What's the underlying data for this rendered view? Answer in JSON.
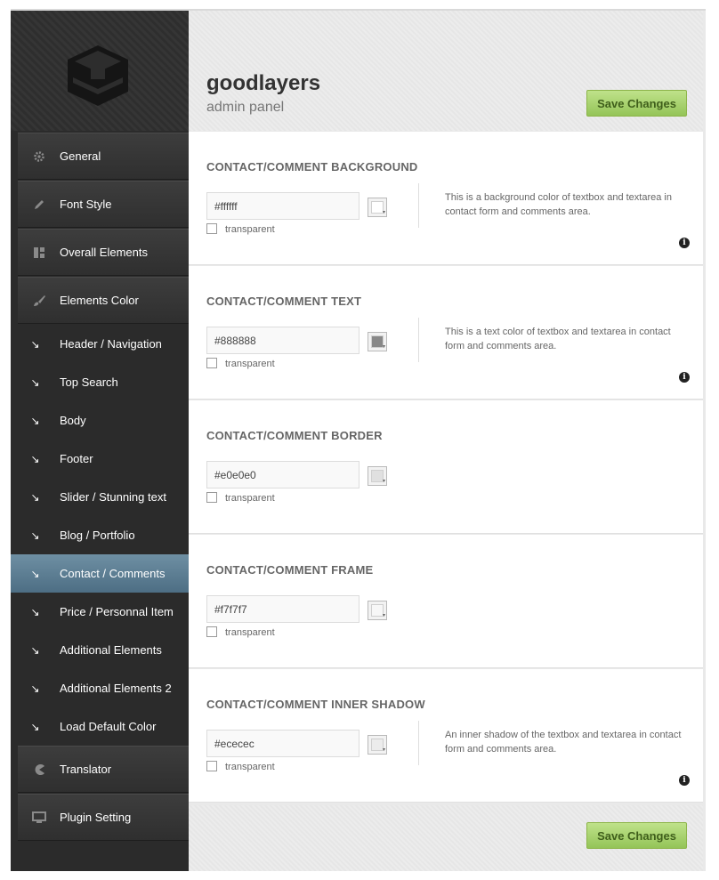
{
  "brand": {
    "title": "goodlayers",
    "subtitle": "admin panel"
  },
  "save_label": "Save Changes",
  "sidebar": {
    "main_items": [
      {
        "label": "General",
        "icon": "gear-icon"
      },
      {
        "label": "Font Style",
        "icon": "pencil-icon"
      },
      {
        "label": "Overall Elements",
        "icon": "layout-icon"
      },
      {
        "label": "Elements Color",
        "icon": "brush-icon"
      }
    ],
    "sub_items": [
      {
        "label": "Header / Navigation"
      },
      {
        "label": "Top Search"
      },
      {
        "label": "Body"
      },
      {
        "label": "Footer"
      },
      {
        "label": "Slider / Stunning text"
      },
      {
        "label": "Blog / Portfolio"
      },
      {
        "label": "Contact / Comments",
        "active": true
      },
      {
        "label": "Price / Personnal Item"
      },
      {
        "label": "Additional Elements"
      },
      {
        "label": "Additional Elements 2"
      },
      {
        "label": "Load Default Color"
      }
    ],
    "bottom_items": [
      {
        "label": "Translator",
        "icon": "pacman-icon"
      },
      {
        "label": "Plugin Setting",
        "icon": "monitor-icon"
      }
    ]
  },
  "sections": [
    {
      "title": "CONTACT/COMMENT BACKGROUND",
      "value": "#ffffff",
      "checkbox_label": "transparent",
      "description": "This is a background color of textbox and textarea in contact form and comments area.",
      "swatch": "#ffffff"
    },
    {
      "title": "CONTACT/COMMENT TEXT",
      "value": "#888888",
      "checkbox_label": "transparent",
      "description": "This is a text color of textbox and textarea in contact form and comments area.",
      "swatch": "#888888"
    },
    {
      "title": "CONTACT/COMMENT BORDER",
      "value": "#e0e0e0",
      "checkbox_label": "transparent",
      "description": "",
      "swatch": "#e0e0e0"
    },
    {
      "title": "CONTACT/COMMENT FRAME",
      "value": "#f7f7f7",
      "checkbox_label": "transparent",
      "description": "",
      "swatch": "#f7f7f7"
    },
    {
      "title": "CONTACT/COMMENT INNER SHADOW",
      "value": "#ececec",
      "checkbox_label": "transparent",
      "description": "An inner shadow of the textbox and textarea in contact form and comments area.",
      "swatch": "#ececec"
    }
  ]
}
